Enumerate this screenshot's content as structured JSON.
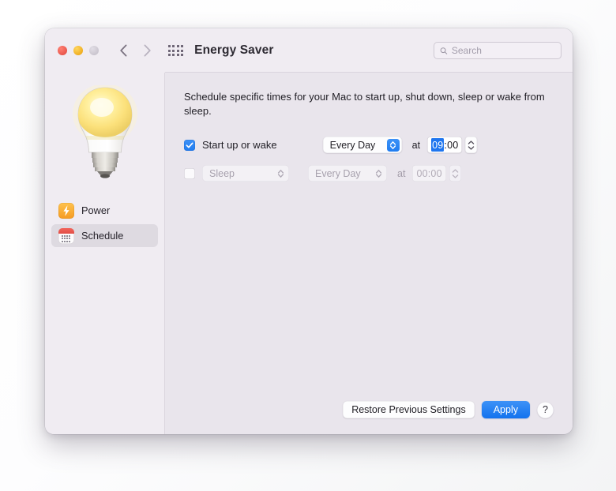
{
  "window": {
    "title": "Energy Saver",
    "traffic_lights": [
      "close-red",
      "minimize-yellow",
      "zoom-disabled-grey"
    ],
    "nav": {
      "back": "back-chevron",
      "forward": "forward-chevron"
    },
    "grid_icon": "show-all-grid-icon"
  },
  "search": {
    "placeholder": "Search",
    "value": "",
    "icon": "search-icon"
  },
  "sidebar": {
    "hero_icon": "light-bulb-illustration",
    "items": [
      {
        "label": "Power",
        "icon": "power-bolt-icon",
        "selected": false
      },
      {
        "label": "Schedule",
        "icon": "schedule-calendar-icon",
        "selected": true
      }
    ]
  },
  "main": {
    "intro": "Schedule specific times for your Mac to start up, shut down, sleep or wake from sleep.",
    "at_label": "at",
    "rows": [
      {
        "id": "startup-or-wake",
        "checked": true,
        "enabled": true,
        "label": "Start up or wake",
        "has_action_popup": false,
        "day": "Every Day",
        "time": "09:00",
        "time_hour": "09",
        "time_rest": ":00",
        "hour_selected": true
      },
      {
        "id": "sleep",
        "checked": false,
        "enabled": false,
        "label": "",
        "has_action_popup": true,
        "action": "Sleep",
        "day": "Every Day",
        "time": "00:00",
        "time_hour": "00",
        "time_rest": ":00",
        "hour_selected": false
      }
    ]
  },
  "footer": {
    "restore_label": "Restore Previous Settings",
    "apply_label": "Apply",
    "help_label": "?"
  },
  "colors": {
    "accent_blue": "#1f76ef",
    "window_bg": "#e9e5ec",
    "sidebar_bg": "#f0ecf2",
    "toolbar_bg": "#f0ecf2",
    "selected_row_bg": "#dedae1",
    "traffic_red": "#e8544a",
    "traffic_yellow": "#eeab1e",
    "traffic_grey": "#c9c4ce",
    "power_icon_orange": "#f59b22",
    "schedule_icon_red": "#e14e46"
  }
}
